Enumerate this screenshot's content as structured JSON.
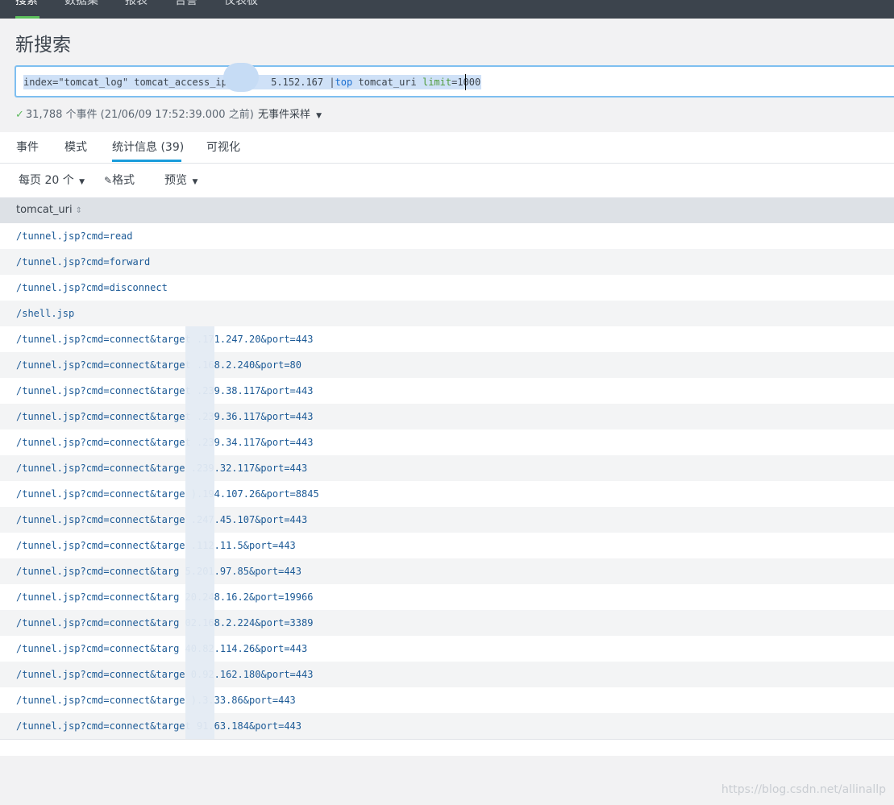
{
  "top_nav": {
    "items": [
      "搜索",
      "数据集",
      "报表",
      "告警",
      "仪表板"
    ],
    "active_index": 0
  },
  "page_title": "新搜索",
  "search": {
    "query_part1": "index=\"tomcat_log\" tomcat_access_ip=",
    "query_part2": "5.152.167 |",
    "query_kw_top": "top",
    "query_part3": " tomcat_uri ",
    "query_fn_limit": "limit",
    "query_part4": "=1000"
  },
  "status": {
    "event_summary": "31,788 个事件 (21/06/09 17:52:39.000 之前)",
    "sampling_label": "无事件采样"
  },
  "tabs": [
    {
      "label": "事件"
    },
    {
      "label": "模式"
    },
    {
      "label": "统计信息 (39)"
    },
    {
      "label": "可视化"
    }
  ],
  "toolbar": {
    "per_page": "每页 20 个",
    "format": "格式",
    "preview": "预览"
  },
  "table": {
    "column_header": "tomcat_uri",
    "rows": [
      "/tunnel.jsp?cmd=read",
      "/tunnel.jsp?cmd=forward",
      "/tunnel.jsp?cmd=disconnect",
      "/shell.jsp",
      "/tunnel.jsp?cmd=connect&target  .171.247.20&port=443",
      "/tunnel.jsp?cmd=connect&target  .168.2.240&port=80",
      "/tunnel.jsp?cmd=connect&target  .239.38.117&port=443",
      "/tunnel.jsp?cmd=connect&target  .239.36.117&port=443",
      "/tunnel.jsp?cmd=connect&target  .239.34.117&port=443",
      "/tunnel.jsp?cmd=connect&targe  .239.32.117&port=443",
      "/tunnel.jsp?cmd=connect&targe  ).194.107.26&port=8845",
      "/tunnel.jsp?cmd=connect&targe  .247.45.107&port=443",
      "/tunnel.jsp?cmd=connect&targe  .112.11.5&port=443",
      "/tunnel.jsp?cmd=connect&targ  5.201.97.85&port=443",
      "/tunnel.jsp?cmd=connect&targ  20.248.16.2&port=19966",
      "/tunnel.jsp?cmd=connect&targ  02.168.2.224&port=3389",
      "/tunnel.jsp?cmd=connect&targ  40.82.114.26&port=443",
      "/tunnel.jsp?cmd=connect&targe  0.92.162.180&port=443",
      "/tunnel.jsp?cmd=connect&targe  ).3.33.86&port=443",
      "/tunnel.jsp?cmd=connect&target  91.63.184&port=443"
    ]
  },
  "watermark": "https://blog.csdn.net/allinallp",
  "colors": {
    "nav_bg": "#3c444d",
    "accent_green": "#5cc05c",
    "tab_accent": "#1a9cdb",
    "link_text": "#1c5a96"
  }
}
